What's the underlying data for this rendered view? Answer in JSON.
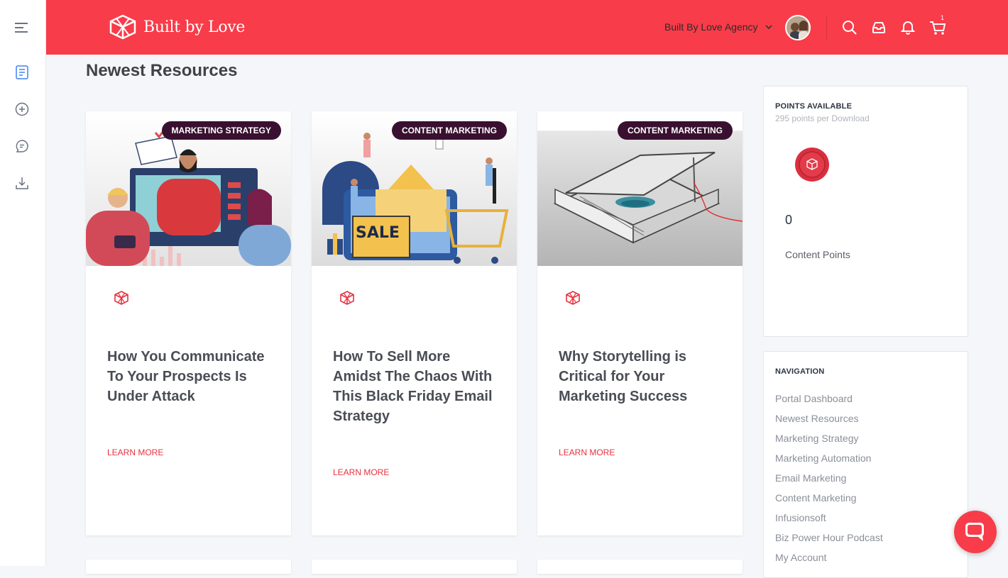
{
  "brand": {
    "name": "Built by Love",
    "accent": "#f83c49",
    "badge_color": "#3a1030"
  },
  "header": {
    "agency_name": "Built By Love Agency",
    "cart_count": "1",
    "icons": [
      "search-icon",
      "inbox-icon",
      "bell-icon",
      "cart-icon"
    ]
  },
  "sidebar": {
    "icons": [
      "menu-icon",
      "resources-icon",
      "add-icon",
      "chat-icon",
      "download-icon"
    ]
  },
  "main": {
    "title": "Newest Resources",
    "cards": [
      {
        "badge": "MARKETING STRATEGY",
        "title": "How You Communicate To Your Prospects Is Under Attack",
        "link": "LEARN MORE"
      },
      {
        "badge": "CONTENT MARKETING",
        "title": "How To Sell More Amidst The Chaos With This Black Friday Email Strategy",
        "link": "LEARN MORE"
      },
      {
        "badge": "CONTENT MARKETING",
        "title": "Why Storytelling is Critical for Your Marketing Success",
        "link": "LEARN MORE"
      }
    ]
  },
  "points": {
    "heading": "POINTS AVAILABLE",
    "subheading": "295 points per Download",
    "value": "0",
    "label": "Content Points"
  },
  "navigation": {
    "heading": "NAVIGATION",
    "items": [
      "Portal Dashboard",
      "Newest Resources",
      "Marketing Strategy",
      "Marketing Automation",
      "Email Marketing",
      "Content Marketing",
      "Infusionsoft",
      "Biz Power Hour Podcast",
      "My Account"
    ]
  }
}
